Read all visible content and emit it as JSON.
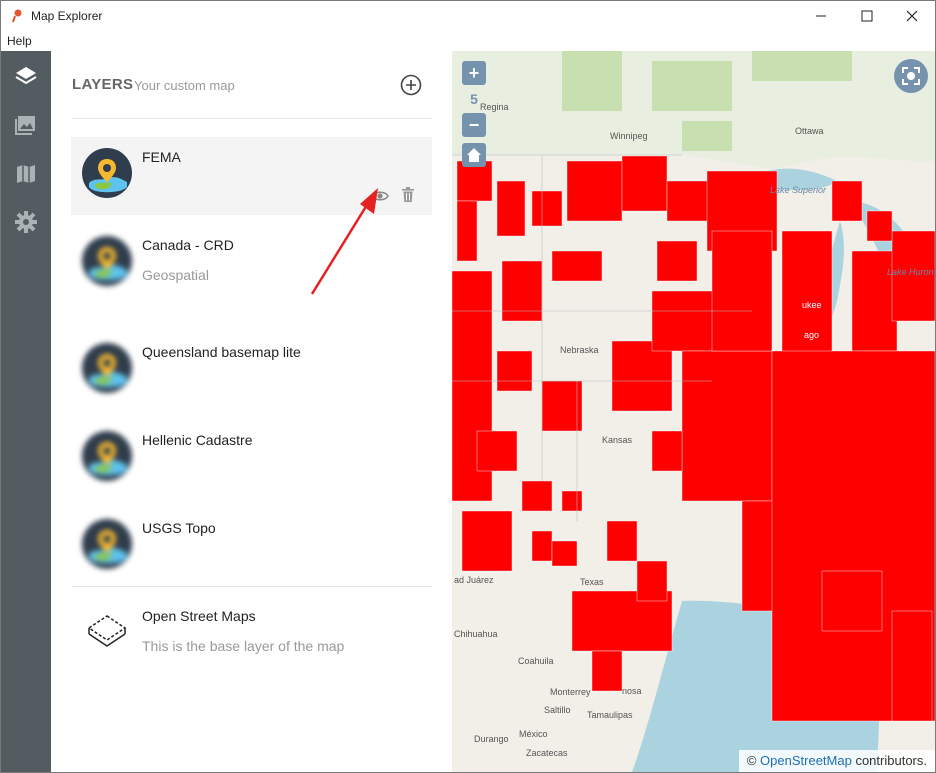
{
  "window": {
    "title": "Map Explorer",
    "minimize": "—",
    "maximize": "☐",
    "close": "✕"
  },
  "menu": {
    "help": "Help"
  },
  "sidebar": {
    "icons": [
      "layers-icon",
      "image-icon",
      "map-icon",
      "settings-icon"
    ]
  },
  "panel": {
    "title": "LAYERS",
    "subtitle": "Your custom map",
    "layers": [
      {
        "name": "FEMA",
        "description": ""
      },
      {
        "name": "Canada - CRD",
        "description": "Geospatial"
      },
      {
        "name": "Queensland basemap lite",
        "description": ""
      },
      {
        "name": "Hellenic Cadastre",
        "description": ""
      },
      {
        "name": "USGS Topo",
        "description": ""
      }
    ],
    "base_layer": {
      "name": "Open Street Maps",
      "description": "This is the base layer of the map"
    }
  },
  "map": {
    "zoom_in": "+",
    "zoom_out": "−",
    "zoom_level": "5",
    "attribution_prefix": "©",
    "attribution_link": "OpenStreetMap",
    "attribution_suffix": "contributors.",
    "labels": {
      "regina": "Regina",
      "winnipeg": "Winnipeg",
      "ottawa": "Ottawa",
      "lake_superior": "Lake Superior",
      "lake_huron": "Lake Huron",
      "milwaukee": "ukee",
      "chicago": "ago",
      "nebraska": "Nebraska",
      "kansas": "Kansas",
      "texas": "Texas",
      "juarez": "ad Juárez",
      "chihuahua": "Chihuahua",
      "coahuila": "Coahuila",
      "monterrey": "Monterrey",
      "saltillo": "Saltillo",
      "tamaulipas": "Tamaulipas",
      "durango": "Durango",
      "mexico": "México",
      "zacatecas": "Zacatecas",
      "nosa": "nosa"
    },
    "colors": {
      "overlay": "#ff0000",
      "water": "#aad3df",
      "land": "#f2efe9",
      "canada_green": "#c8dfb0"
    }
  }
}
